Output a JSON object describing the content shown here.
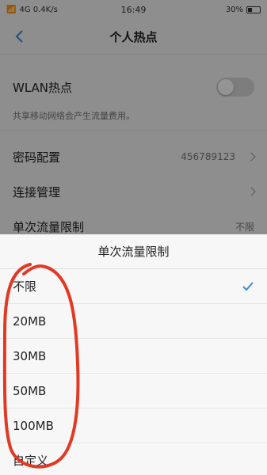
{
  "status_bar": {
    "left": "4G 0.4K/s",
    "time": "16:49",
    "right": "30%"
  },
  "nav": {
    "title": "个人热点"
  },
  "settings": {
    "wlan_label": "WLAN热点",
    "wlan_hint": "共享移动网络会产生流量费用。",
    "password_label": "密码配置",
    "password_value": "456789123",
    "connection_label": "连接管理",
    "limit_label": "单次流量限制",
    "limit_value": "不限"
  },
  "sheet": {
    "title": "单次流量限制",
    "options": [
      {
        "label": "不限",
        "selected": true
      },
      {
        "label": "20MB",
        "selected": false
      },
      {
        "label": "30MB",
        "selected": false
      },
      {
        "label": "50MB",
        "selected": false
      },
      {
        "label": "100MB",
        "selected": false
      },
      {
        "label": "自定义",
        "selected": false
      }
    ]
  },
  "colors": {
    "accent": "#3d8bd9",
    "annotation": "#e03a24"
  }
}
